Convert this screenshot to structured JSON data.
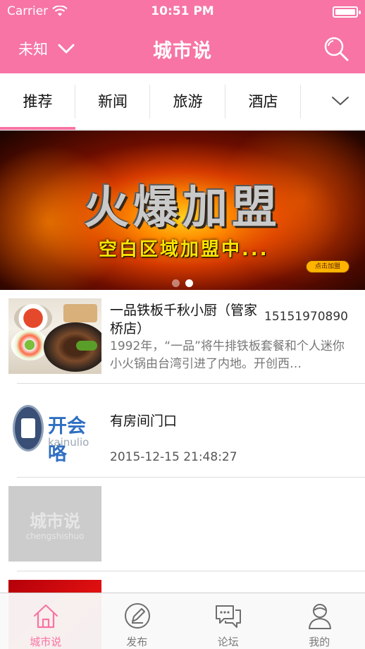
{
  "status_bar": {
    "carrier": "Carrier",
    "time": "10:51 PM",
    "battery_percent": 100
  },
  "header": {
    "city": "未知",
    "title": "城市说",
    "search_icon": "search-icon",
    "accent_color": "#f774a4"
  },
  "tabs": {
    "items": [
      {
        "label": "推荐",
        "active": true
      },
      {
        "label": "新闻",
        "active": false
      },
      {
        "label": "旅游",
        "active": false
      },
      {
        "label": "酒店",
        "active": false
      }
    ],
    "more_icon": "chevron-down-icon"
  },
  "banner": {
    "title": "火爆加盟",
    "subtitle": "空白区域加盟中...",
    "button_label": "点击加盟",
    "slide_count": 2,
    "active_slide": 2
  },
  "list": {
    "items": [
      {
        "title": "一品铁板千秋小厨（管家桥店）",
        "phone": "15151970890",
        "description": "1992年，“一品”将牛排铁板套餐和个人迷你小火锅由台湾引进了内地。开创西…"
      },
      {
        "title": "有房间门口",
        "date": "2015-12-15 21:48:27",
        "logo_cn": "开会咯",
        "logo_en": "kainulio"
      },
      {
        "placeholder_cn": "城市说",
        "placeholder_en": "chengshishuo"
      }
    ]
  },
  "tabbar": {
    "items": [
      {
        "label": "城市说",
        "icon": "home-icon",
        "active": true
      },
      {
        "label": "发布",
        "icon": "compose-icon",
        "active": false
      },
      {
        "label": "论坛",
        "icon": "chat-bubbles-icon",
        "active": false
      },
      {
        "label": "我的",
        "icon": "user-icon",
        "active": false
      }
    ]
  }
}
